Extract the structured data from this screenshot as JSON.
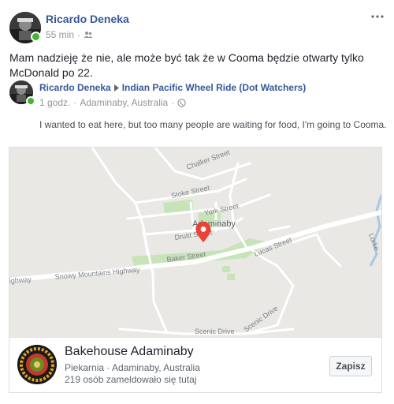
{
  "post": {
    "author": "Ricardo Deneka",
    "time": "55 min",
    "text": "Mam nadzieję że nie, ale może być tak że w Cooma będzie otwarty tylko McDonald po 22.",
    "options_icon": "more-horizontal-icon",
    "audience_icon": "friends-icon"
  },
  "shared": {
    "author": "Ricardo Deneka",
    "group": "Indian Pacific Wheel Ride (Dot Watchers)",
    "time": "1 godz.",
    "location": "Adaminaby, Australia",
    "audience_icon": "globe-icon",
    "text": "I wanted to eat here, but too many people are waiting for food, I'm going to Cooma."
  },
  "map": {
    "labels": {
      "chalker": "Chalker Street",
      "stoke": "Stoke Street",
      "york": "York Street",
      "town": "Adaminaby",
      "druitt": "Druitt Street",
      "baker": "Baker Street",
      "lucas": "Lucas Street",
      "snowy": "Snowy Mountains Highway",
      "highway_left": "ighway",
      "scenic": "Scenic Drive",
      "scenic2": "Scenic Drive",
      "lorke": "Lorke"
    },
    "pin_color": "#ea4335"
  },
  "place": {
    "name": "Bakehouse Adaminaby",
    "category": "Piekarnia",
    "location": "Adaminaby, Australia",
    "checkins": "219 osób zameldowało się tutaj",
    "save_label": "Zapisz"
  }
}
